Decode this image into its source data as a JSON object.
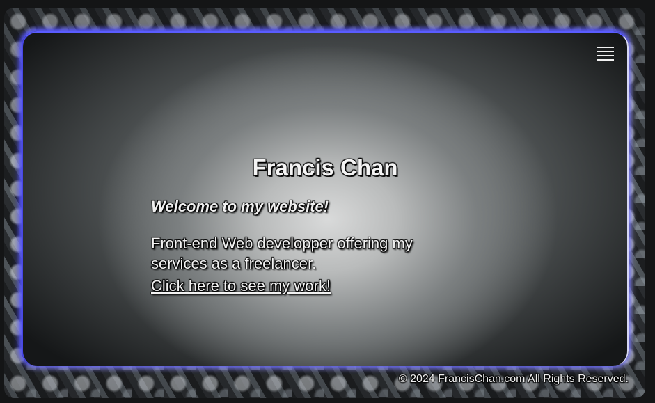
{
  "nav": {
    "menu_icon": "hamburger-menu-icon"
  },
  "hero": {
    "name": "Francis Chan",
    "welcome": "Welcome to my website!",
    "description": "Front-end Web developper offering my services as a freelancer.",
    "work_link": "Click here to see my work!"
  },
  "footer": {
    "copyright": "© 2024 FrancisChan.com All Rights Reserved."
  },
  "colors": {
    "page_background": "#141516",
    "panel_glow": "#5a5cff",
    "text": "#f2f2f2"
  }
}
